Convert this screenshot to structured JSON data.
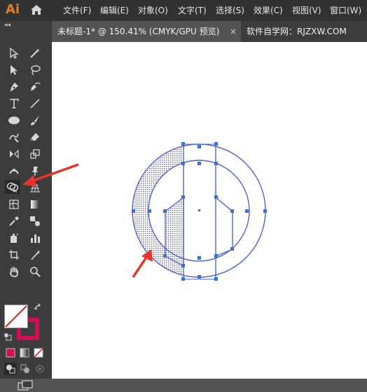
{
  "app": {
    "logo_text": "Ai",
    "brand_color": "#d9822b"
  },
  "menu": [
    {
      "label": "文件(F)"
    },
    {
      "label": "编辑(E)"
    },
    {
      "label": "对象(O)"
    },
    {
      "label": "文字(T)"
    },
    {
      "label": "选择(S)"
    },
    {
      "label": "效果(C)"
    },
    {
      "label": "视图(V)"
    },
    {
      "label": "窗口(W)"
    }
  ],
  "document_tab": {
    "title": "未标题-1* @ 150.41% (CMYK/GPU 预览)",
    "close": "×"
  },
  "watermark": "软件自学网：RJZXW.COM",
  "toolbar": {
    "collapse_glyph": "◂◂",
    "selected_tool": "shape-builder-tool",
    "fill_color": "none",
    "stroke_color": "#d10f55",
    "tools": [
      "selection-tool",
      "direct-selection-tool",
      "magic-wand-tool",
      "lasso-tool",
      "pen-tool",
      "curvature-tool",
      "type-tool",
      "line-segment-tool",
      "ellipse-tool",
      "paintbrush-tool",
      "shaper-tool",
      "eraser-tool",
      "reflect-tool",
      "scale-tool",
      "width-tool",
      "puppet-warp-tool",
      "shape-builder-tool",
      "perspective-grid-tool",
      "mesh-tool",
      "gradient-tool",
      "eyedropper-tool",
      "blend-tool",
      "symbol-sprayer-tool",
      "column-graph-tool",
      "artboard-tool",
      "slice-tool",
      "hand-tool",
      "zoom-tool"
    ]
  },
  "colors": {
    "artwork_stroke": "#8e4fc4",
    "selection": "#3a6fe0",
    "arrow": "#e8352c"
  }
}
